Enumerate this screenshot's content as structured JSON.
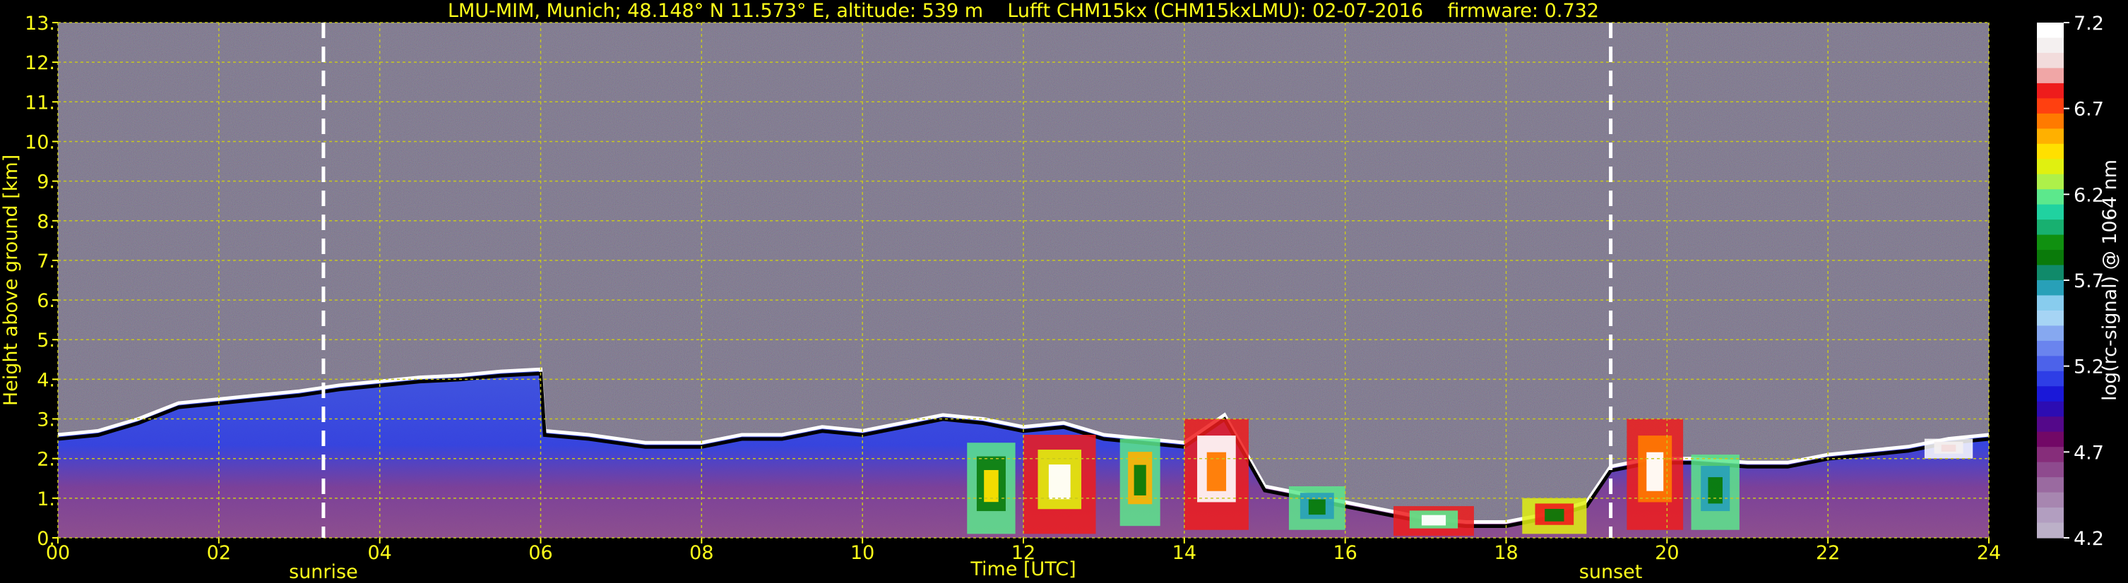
{
  "header": {
    "title": "LMU-MIM, Munich; 48.148° N 11.573° E, altitude: 539 m    Lufft CHM15kx (CHM15kxLMU): 02-07-2016    firmware: 0.732"
  },
  "colors": {
    "background": "#000000",
    "axis_text": "#ffff1a",
    "grid": "#c8c81e",
    "noise_base": "#6e6680",
    "marker_line": "#ffffff"
  },
  "chart_data": {
    "type": "heatmap",
    "title": "LMU-MIM, Munich; 48.148° N 11.573° E, altitude: 539 m    Lufft CHM15kx (CHM15kxLMU): 02-07-2016    firmware: 0.732",
    "xlabel": "Time [UTC]",
    "ylabel": "Height above ground [km]",
    "xlim": [
      0,
      24
    ],
    "ylim": [
      0,
      13
    ],
    "x_ticks": [
      "00",
      "02",
      "04",
      "06",
      "08",
      "10",
      "12",
      "14",
      "16",
      "18",
      "20",
      "22",
      "24"
    ],
    "y_ticks": [
      "0.",
      "1.",
      "2.",
      "3.",
      "4.",
      "5.",
      "6.",
      "7.",
      "8.",
      "9.",
      "10.",
      "11.",
      "12.",
      "13."
    ],
    "grid": true,
    "markers": [
      {
        "label": "sunrise",
        "time_h": 3.3
      },
      {
        "label": "sunset",
        "time_h": 19.3
      }
    ],
    "boundary_layer_top_km": [
      [
        0,
        2.6
      ],
      [
        0.5,
        2.7
      ],
      [
        1.0,
        3.0
      ],
      [
        1.5,
        3.4
      ],
      [
        2.0,
        3.5
      ],
      [
        2.5,
        3.6
      ],
      [
        3.0,
        3.7
      ],
      [
        3.5,
        3.85
      ],
      [
        4.0,
        3.95
      ],
      [
        4.5,
        4.05
      ],
      [
        5.0,
        4.1
      ],
      [
        5.5,
        4.2
      ],
      [
        6.0,
        4.25
      ],
      [
        6.05,
        2.7
      ],
      [
        6.6,
        2.6
      ],
      [
        7.3,
        2.4
      ],
      [
        8.0,
        2.4
      ],
      [
        8.5,
        2.6
      ],
      [
        9.0,
        2.6
      ],
      [
        9.5,
        2.8
      ],
      [
        10.0,
        2.7
      ],
      [
        10.5,
        2.9
      ],
      [
        11.0,
        3.1
      ],
      [
        11.5,
        3.0
      ],
      [
        12.0,
        2.8
      ],
      [
        12.5,
        2.9
      ],
      [
        13.0,
        2.6
      ],
      [
        13.5,
        2.5
      ],
      [
        14.0,
        2.4
      ],
      [
        14.5,
        3.1
      ],
      [
        15.0,
        1.3
      ],
      [
        15.5,
        1.1
      ],
      [
        16.0,
        0.9
      ],
      [
        16.5,
        0.7
      ],
      [
        17.0,
        0.5
      ],
      [
        17.5,
        0.4
      ],
      [
        18.0,
        0.4
      ],
      [
        18.5,
        0.6
      ],
      [
        19.0,
        0.9
      ],
      [
        19.3,
        1.8
      ],
      [
        19.8,
        2.0
      ],
      [
        20.3,
        2.0
      ],
      [
        21.0,
        1.9
      ],
      [
        21.5,
        1.9
      ],
      [
        22.0,
        2.1
      ],
      [
        22.5,
        2.2
      ],
      [
        23.0,
        2.3
      ],
      [
        23.5,
        2.5
      ],
      [
        24.0,
        2.6
      ]
    ],
    "colorbar": {
      "label": "log(rc-signal) @ 1064 nm",
      "min": 4.2,
      "max": 7.2,
      "tick_labels": [
        "7.2",
        "6.7",
        "6.2",
        "5.7",
        "5.2",
        "4.7",
        "4.2"
      ],
      "tick_values": [
        7.2,
        6.7,
        6.2,
        5.7,
        5.2,
        4.7,
        4.2
      ],
      "colors_top_to_bottom": [
        "#ffffff",
        "#f4f0f0",
        "#f2dcdc",
        "#f0a6a6",
        "#ee1c1c",
        "#ff4010",
        "#ff7a00",
        "#ffb000",
        "#ffe000",
        "#e0f010",
        "#aef04a",
        "#5ce88c",
        "#20d2a0",
        "#18b070",
        "#109010",
        "#0a7a0a",
        "#108a6a",
        "#28a0b8",
        "#88ccee",
        "#a6d4f4",
        "#86a8f0",
        "#6a84ee",
        "#4c62ea",
        "#2e3ee6",
        "#1a18d8",
        "#2c0cb2",
        "#54088a",
        "#720866",
        "#862d7a",
        "#8e4a8e",
        "#9a6aa0",
        "#a786b0",
        "#b29ec0",
        "#bcb0c8"
      ]
    }
  }
}
